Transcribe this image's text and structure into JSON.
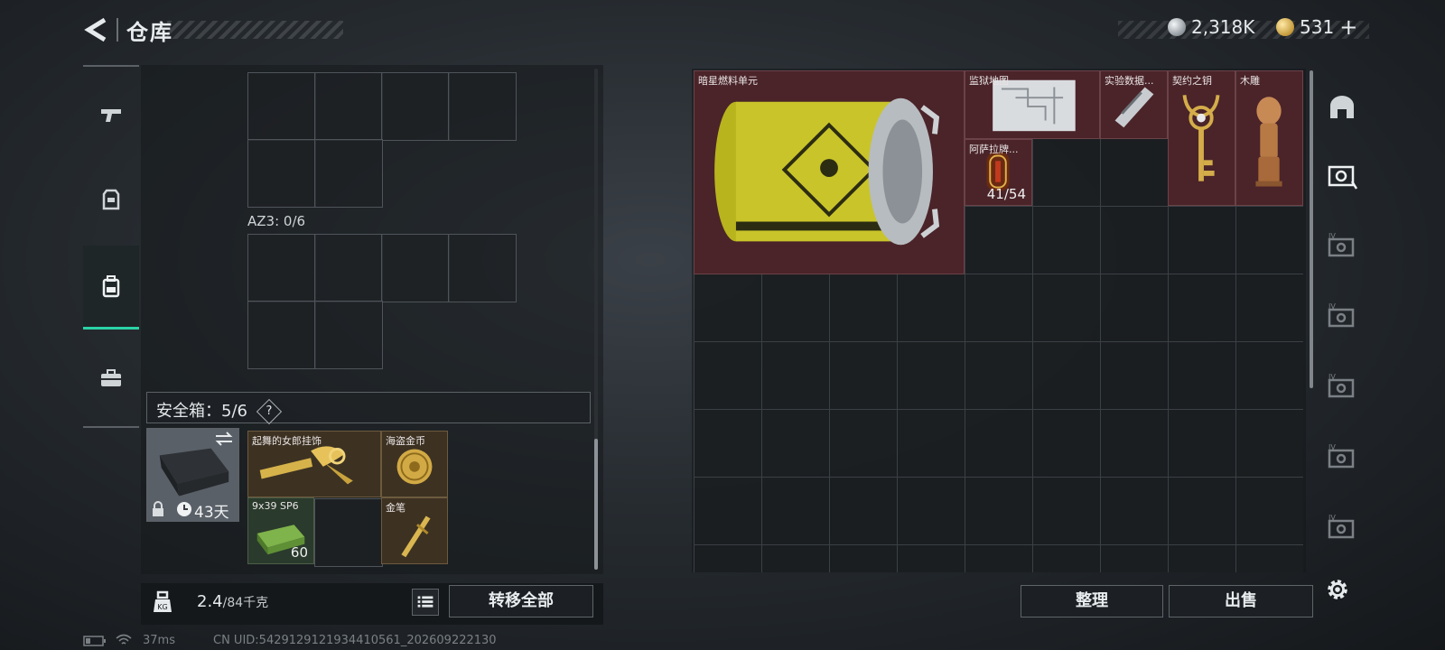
{
  "header": {
    "title": "仓库",
    "currencies": [
      {
        "icon": "silver-coin-icon",
        "value": "2,318K"
      },
      {
        "icon": "gold-coin-icon",
        "value": "531"
      }
    ],
    "plus_label": "+"
  },
  "left_nav": {
    "items": [
      {
        "icon": "pistol-icon",
        "active": false
      },
      {
        "icon": "armor-vest-icon",
        "active": false
      },
      {
        "icon": "backpack-icon",
        "active": true
      },
      {
        "icon": "toolbox-icon",
        "active": false
      }
    ]
  },
  "containers": {
    "az3_label": "AZ3: 0/6",
    "safe_box_label": "安全箱：5/6",
    "help_label": "?",
    "case_timer": "43天"
  },
  "safe_items": [
    {
      "name": "起舞的女郎挂饰",
      "qty": ""
    },
    {
      "name": "海盗金币",
      "qty": ""
    },
    {
      "name": "9x39 SP6",
      "qty": "60"
    },
    {
      "name": "金笔",
      "qty": ""
    }
  ],
  "weight": {
    "current": "2.4",
    "max": "/84千克"
  },
  "buttons": {
    "transfer_all": "转移全部",
    "sort": "整理",
    "sell": "出售"
  },
  "stash_items": [
    {
      "name": "暗星燃料单元",
      "qty": ""
    },
    {
      "name": "监狱地图",
      "qty": ""
    },
    {
      "name": "实验数据...",
      "qty": ""
    },
    {
      "name": "契约之钥",
      "qty": ""
    },
    {
      "name": "木雕",
      "qty": ""
    },
    {
      "name": "阿萨拉牌...",
      "qty": "41/54"
    }
  ],
  "right_nav": {
    "items": [
      {
        "icon": "bunker-icon"
      },
      {
        "icon": "stash-tab-icon",
        "active": true
      },
      {
        "icon": "stash-tab-iv-icon",
        "label": "IV"
      },
      {
        "icon": "stash-tab-iv-icon",
        "label": "IV"
      },
      {
        "icon": "stash-tab-iv-icon",
        "label": "IV"
      },
      {
        "icon": "stash-tab-iv-icon",
        "label": "IV"
      },
      {
        "icon": "stash-tab-iv-icon",
        "label": "IV"
      }
    ],
    "settings_icon": "gear-icon"
  },
  "status": {
    "ping": "37ms",
    "uid": "CN UID:5429129121934410561_202609222130"
  }
}
